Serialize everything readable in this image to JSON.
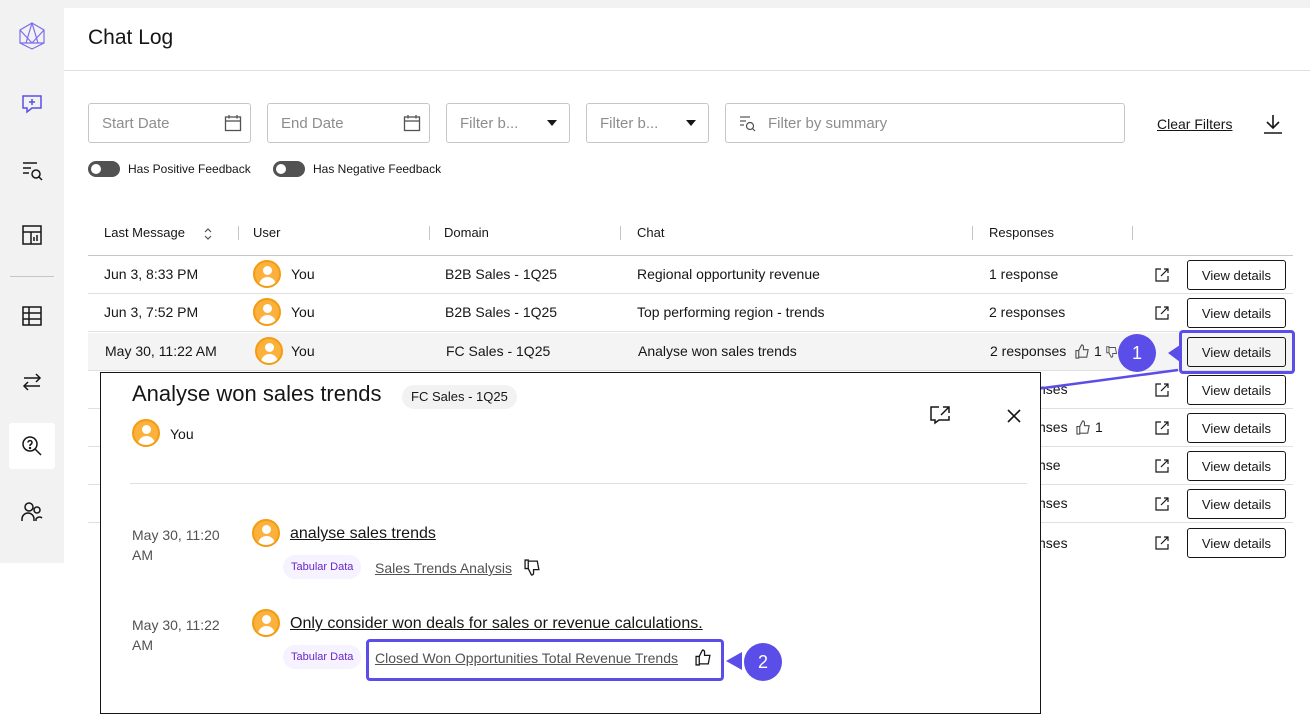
{
  "page": {
    "title": "Chat Log"
  },
  "sidebar": {
    "items": [
      {
        "icon": "logo-icon"
      },
      {
        "icon": "new-chat-icon"
      },
      {
        "icon": "search-list-icon"
      },
      {
        "icon": "dashboard-icon"
      },
      {
        "icon": "table-icon"
      },
      {
        "icon": "transfer-icon"
      },
      {
        "icon": "chat-log-icon",
        "active": true
      },
      {
        "icon": "users-icon"
      }
    ]
  },
  "filters": {
    "start_date": "Start Date",
    "end_date": "End Date",
    "filter_1": "Filter b...",
    "filter_2": "Filter b...",
    "summary": "Filter by summary",
    "clear": "Clear Filters",
    "positive": "Has Positive Feedback",
    "negative": "Has Negative Feedback"
  },
  "table": {
    "headers": [
      "Last Message",
      "User",
      "Domain",
      "Chat",
      "Responses"
    ],
    "view_label": "View details",
    "rows": [
      {
        "time": "Jun 3, 8:33 PM",
        "user": "You",
        "domain": "B2B Sales - 1Q25",
        "chat": "Regional opportunity revenue",
        "responses": "1 response"
      },
      {
        "time": "Jun 3, 7:52 PM",
        "user": "You",
        "domain": "B2B Sales - 1Q25",
        "chat": "Top performing region - trends",
        "responses": "2 responses"
      },
      {
        "time": "May 30, 11:22 AM",
        "user": "You",
        "domain": "FC Sales - 1Q25",
        "chat": "Analyse won sales trends",
        "responses": "2 responses",
        "likes": "1"
      },
      {
        "responses": "nses"
      },
      {
        "responses": "nses",
        "likes": "1"
      },
      {
        "responses": "nse"
      },
      {
        "responses": "nses"
      },
      {
        "responses": "nses"
      }
    ]
  },
  "callouts": {
    "one": "1",
    "two": "2",
    "color": "#5b4ee8"
  },
  "panel": {
    "title": "Analyse won sales trends",
    "domain_tag": "FC Sales - 1Q25",
    "user": "You",
    "messages": [
      {
        "time": "May 30, 11:20 AM",
        "text": "analyse sales trends",
        "chip": "Tabular Data",
        "result": "Sales Trends Analysis",
        "feedback": "thumbs-down"
      },
      {
        "time": "May 30, 11:22 AM",
        "text": "Only consider won deals for sales or revenue calculations.",
        "chip": "Tabular Data",
        "result": "Closed Won Opportunities Total Revenue Trends",
        "feedback": "thumbs-up"
      }
    ]
  }
}
